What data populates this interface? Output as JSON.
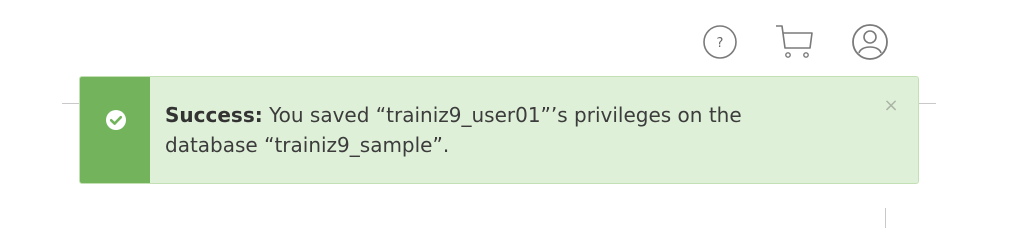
{
  "header": {
    "icons": [
      "help-icon",
      "cart-icon",
      "user-icon"
    ],
    "help_glyph": "?"
  },
  "alert": {
    "type": "success",
    "title": "Success:",
    "message": "You saved “trainiz9_user01”’s privileges on the database “trainiz9_sample”.",
    "close_glyph": "×",
    "colors": {
      "background": "#dff0d8",
      "stripe": "#72b35c",
      "border": "#c3e0b5",
      "text": "#3c3c3c"
    }
  }
}
